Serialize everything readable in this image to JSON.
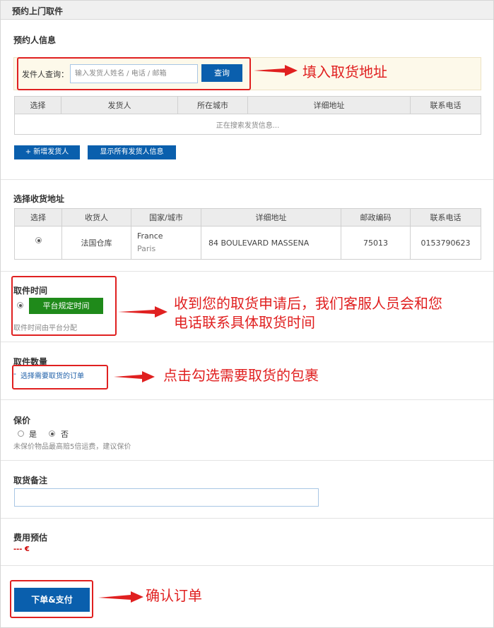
{
  "header": {
    "title": "预约上门取件"
  },
  "sender_section": {
    "title": "预约人信息",
    "search_label": "发件人查询：",
    "search_placeholder": "输入发货人姓名 / 电话 / 邮箱",
    "search_button": "查询",
    "columns": [
      "选择",
      "发货人",
      "所在城市",
      "详细地址",
      "联系电话"
    ],
    "loading_text": "正在搜索发货信息...",
    "add_button": "+ 新增发货人",
    "show_all_button": "显示所有发货人信息"
  },
  "receiver_section": {
    "title": "选择收货地址",
    "columns": [
      "选择",
      "收货人",
      "国家/城市",
      "详细地址",
      "邮政编码",
      "联系电话"
    ],
    "rows": [
      {
        "selected": true,
        "receiver": "法国仓库",
        "country": "France",
        "city": "Paris",
        "address": "84 BOULEVARD MASSENA",
        "postcode": "75013",
        "phone": "0153790623"
      }
    ]
  },
  "pickup_time": {
    "title": "取件时间",
    "option_label": "平台规定时间",
    "hint": "取件时间由平台分配"
  },
  "pickup_quantity": {
    "title": "取件数量",
    "bullet": "-",
    "select_button": "选择需要取货的订单"
  },
  "insurance": {
    "title": "保价",
    "options": [
      {
        "label": "是",
        "selected": false
      },
      {
        "label": "否",
        "selected": true
      }
    ],
    "hint": "未保价物品最高赔5倍运费，建议保价"
  },
  "remark": {
    "title": "取货备注",
    "value": ""
  },
  "cost": {
    "title": "费用预估",
    "value": "--- €"
  },
  "submit_button": "下单&支付",
  "annotations": {
    "fill_address": "填入取货地址",
    "pickup_time_line1": "收到您的取货申请后，我们客服人员会和您",
    "pickup_time_line2": "电话联系具体取货时间",
    "select_package": "点击勾选需要取货的包裹",
    "confirm_order": "确认订单"
  },
  "colors": {
    "primary_blue": "#0a5fad",
    "green": "#1f8a1a",
    "annotation_red": "#e02020",
    "search_bg": "#fdf9ea"
  }
}
